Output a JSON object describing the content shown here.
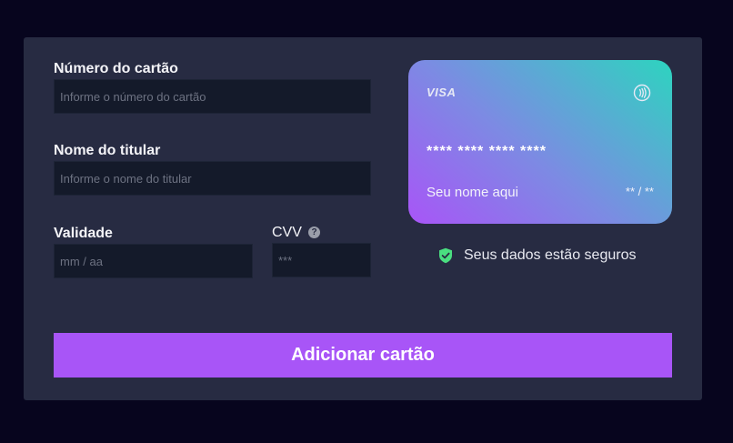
{
  "form": {
    "card_number_label": "Número do cartão",
    "card_number_placeholder": "Informe o número do cartão",
    "holder_label": "Nome do titular",
    "holder_placeholder": "Informe o nome do titular",
    "expiry_label": "Validade",
    "expiry_placeholder": "mm / aa",
    "cvv_label": "CVV",
    "cvv_help_glyph": "?",
    "cvv_placeholder": "***"
  },
  "card_preview": {
    "brand": "VISA",
    "contactless_icon": "contactless-icon",
    "number": "**** **** **** ****",
    "holder": "Seu nome aqui",
    "expiry": "** / **"
  },
  "security": {
    "icon": "shield-check-icon",
    "text": "Seus dados estão seguros"
  },
  "submit_label": "Adicionar cartão",
  "colors": {
    "background": "#07051e",
    "panel": "#272b42",
    "input": "#141a2a",
    "accent": "#a855f7",
    "shield": "#4ade80"
  }
}
